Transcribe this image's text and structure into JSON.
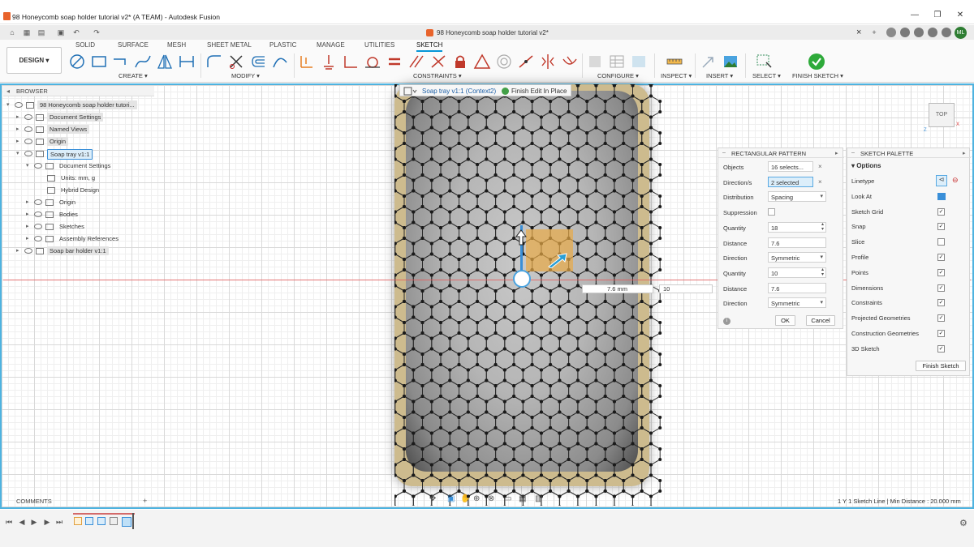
{
  "window": {
    "title": "98 Honeycomb soap holder tutorial v2* (A TEAM) - Autodesk Fusion",
    "minimize": "—",
    "maximize": "❐",
    "close": "✕"
  },
  "doc_tab": {
    "label": "98 Honeycomb soap holder tutorial v2*",
    "close": "×"
  },
  "user": {
    "initials": "ML",
    "avatar_color": "#2e7d32"
  },
  "ribbon": {
    "workspace": "DESIGN",
    "tabs": [
      "SOLID",
      "SURFACE",
      "MESH",
      "SHEET METAL",
      "PLASTIC",
      "MANAGE",
      "UTILITIES",
      "SKETCH"
    ],
    "active_tab": "SKETCH",
    "groups": {
      "create": "CREATE",
      "modify": "MODIFY",
      "constraints": "CONSTRAINTS",
      "configure": "CONFIGURE",
      "inspect": "INSPECT",
      "insert": "INSERT",
      "select": "SELECT",
      "finish": "FINISH SKETCH"
    },
    "accent": "#0696d7"
  },
  "browser": {
    "header": "BROWSER",
    "items": [
      {
        "label": "98 Honeycomb soap holder tutori...",
        "level": 0,
        "expanded": true
      },
      {
        "label": "Document Settings",
        "level": 1
      },
      {
        "label": "Named Views",
        "level": 1
      },
      {
        "label": "Origin",
        "level": 1
      },
      {
        "label": "Soap tray v1:1",
        "level": 1,
        "expanded": true,
        "active": true
      },
      {
        "label": "Document Settings",
        "level": 2,
        "expanded": true
      },
      {
        "label": "Units: mm, g",
        "level": 3
      },
      {
        "label": "Hybrid Design",
        "level": 3
      },
      {
        "label": "Origin",
        "level": 2
      },
      {
        "label": "Bodies",
        "level": 2
      },
      {
        "label": "Sketches",
        "level": 2
      },
      {
        "label": "Assembly References",
        "level": 2
      },
      {
        "label": "Soap bar holder v1:1",
        "level": 1
      }
    ]
  },
  "comments": {
    "label": "COMMENTS",
    "add": "+"
  },
  "context_pill": {
    "label": "Soap tray v1:1 (Context2)",
    "finish": "Finish Edit In Place"
  },
  "canvas_input": {
    "distance": "7.6 mm",
    "quantity": "10"
  },
  "rect_pattern": {
    "title": "RECTANGULAR PATTERN",
    "rows": [
      {
        "label": "Objects",
        "value": "16 selects...",
        "selected": false,
        "clear": true
      },
      {
        "label": "Direction/s",
        "value": "2 selected",
        "selected": true,
        "clear": true
      },
      {
        "label": "Distribution",
        "value": "Spacing",
        "dropdown": true
      },
      {
        "label": "Suppression",
        "value": "",
        "checkbox": true
      },
      {
        "label": "Quantity",
        "value": "18",
        "spinner": true
      },
      {
        "label": "Distance",
        "value": "7.6"
      },
      {
        "label": "Direction",
        "value": "Symmetric",
        "dropdown": true
      },
      {
        "label": "Quantity",
        "value": "10",
        "spinner": true
      },
      {
        "label": "Distance",
        "value": "7.6"
      },
      {
        "label": "Direction",
        "value": "Symmetric",
        "dropdown": true
      }
    ],
    "ok": "OK",
    "cancel": "Cancel"
  },
  "sketch_palette": {
    "title": "SKETCH PALETTE",
    "section": "Options",
    "rows": [
      {
        "label": "Linetype",
        "kind": "icons"
      },
      {
        "label": "Look At",
        "kind": "icon"
      },
      {
        "label": "Sketch Grid",
        "checked": true
      },
      {
        "label": "Snap",
        "checked": true
      },
      {
        "label": "Slice",
        "checked": false
      },
      {
        "label": "Profile",
        "checked": true
      },
      {
        "label": "Points",
        "checked": true
      },
      {
        "label": "Dimensions",
        "checked": true
      },
      {
        "label": "Constraints",
        "checked": true
      },
      {
        "label": "Projected Geometries",
        "checked": true
      },
      {
        "label": "Construction Geometries",
        "checked": true
      },
      {
        "label": "3D Sketch",
        "checked": true
      }
    ],
    "finish_button": "Finish Sketch"
  },
  "viewcube": {
    "label": "TOP"
  },
  "status": {
    "text": "1 Y 1 Sketch Line | Min Distance : 20.000 mm"
  }
}
